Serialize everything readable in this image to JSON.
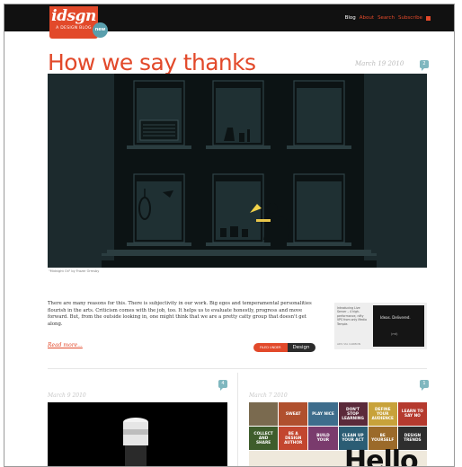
{
  "site": {
    "logo": "idsgn",
    "tagline": "A DESIGN BLOG",
    "badge": "new"
  },
  "nav": {
    "items": [
      "Blog",
      "About",
      "Search",
      "Subscribe"
    ]
  },
  "post": {
    "title": "How we say thanks",
    "date": "March 19 2010",
    "comment_count": "2",
    "caption": "\"Midnight Oil\" by Frazer Ormsby",
    "excerpt": "There are many reasons for this. There is subjectivity in our work. Big egos and temperamental personalities flourish in the arts. Criticism comes with the job, too. It helps us to evaluate honestly, progress and move forward. But, from the outside looking in, one might think that we are a pretty catty group that doesn't get along.",
    "read_more": "Read more...",
    "tag_label": "FILED UNDER",
    "tag_value": "Design"
  },
  "ad": {
    "text": "Introducing Live Server – 4 high-performance, nifty VPS from only Media Temple.",
    "link": "ADS VIA CARBON",
    "box_text": "Ideas. Delivered.",
    "box_sub": "(mt)"
  },
  "next_posts": {
    "left": {
      "date": "March 9 2010",
      "comment_count": "4"
    },
    "right": {
      "date": "March 7 2010",
      "comment_count": "1"
    }
  },
  "tiles": [
    {
      "label": "",
      "color": "#7a6a4f"
    },
    {
      "label": "SWEAT",
      "color": "#b0502e"
    },
    {
      "label": "PLAY NICE",
      "color": "#3e6d8c"
    },
    {
      "label": "DON'T STOP LEARNING",
      "color": "#5b2a3a"
    },
    {
      "label": "DEFINE YOUR AUDIENCE",
      "color": "#c8a23a"
    },
    {
      "label": "LEARN TO SAY NO",
      "color": "#b53a2e"
    },
    {
      "label": "COLLECT AND SHARE",
      "color": "#3f5d2c"
    },
    {
      "label": "BE A DESIGN AUTHOR",
      "color": "#c3462f"
    },
    {
      "label": "BUILD YOUR",
      "color": "#7a3b6d"
    },
    {
      "label": "CLEAN UP YOUR ACT",
      "color": "#2b5d74"
    },
    {
      "label": "BE YOURSELF",
      "color": "#9b6a2a"
    },
    {
      "label": "DESIGN TRENDS",
      "color": "#2e2e2e"
    }
  ],
  "hello": "Hello",
  "colors": {
    "accent": "#e2492a",
    "dark": "#111111",
    "night": "#1c2a2d"
  }
}
